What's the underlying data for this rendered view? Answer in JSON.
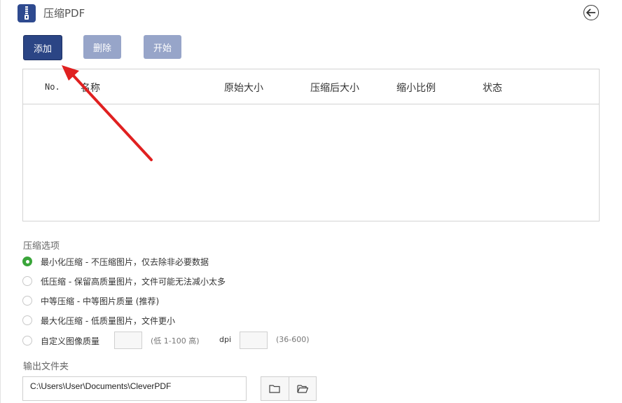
{
  "app": {
    "title": "压缩PDF"
  },
  "toolbar": {
    "add_label": "添加",
    "delete_label": "删除",
    "start_label": "开始"
  },
  "table": {
    "columns": [
      "No.",
      "名称",
      "原始大小",
      "压缩后大小",
      "缩小比例",
      "状态"
    ],
    "rows": []
  },
  "options": {
    "section_label": "压缩选项",
    "items": [
      {
        "label": "最小化压缩 - 不压缩图片，仅去除非必要数据",
        "checked": true
      },
      {
        "label": "低压缩 - 保留高质量图片，文件可能无法减小太多",
        "checked": false
      },
      {
        "label": "中等压缩 - 中等图片质量 (推荐)",
        "checked": false
      },
      {
        "label": "最大化压缩 - 低质量图片，文件更小",
        "checked": false
      },
      {
        "label": "自定义图像质量",
        "checked": false
      }
    ],
    "quality_range": "(低 1-100 高)",
    "dpi_label": "dpi",
    "dpi_range": "(36-600)"
  },
  "output": {
    "section_label": "输出文件夹",
    "path": "C:\\Users\\User\\Documents\\CleverPDF"
  },
  "icons": {
    "app": "zip-icon",
    "back": "back-arrow-icon",
    "folder": "folder-icon",
    "open_folder": "folder-open-icon"
  },
  "colors": {
    "primary_button": "#2b4585",
    "disabled_button": "#97a5c9",
    "selected_radio": "#3aa53a",
    "annotation_arrow": "#e02020"
  }
}
